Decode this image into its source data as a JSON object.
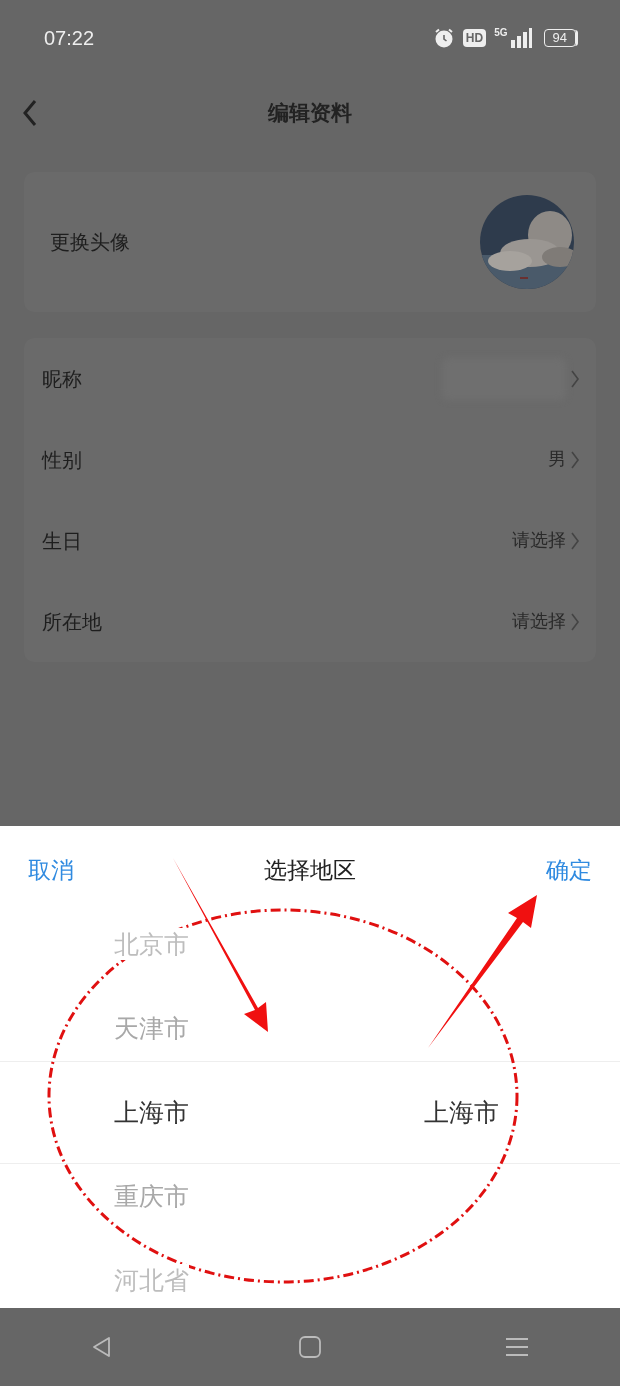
{
  "status_bar": {
    "time": "07:22",
    "hd": "HD",
    "network": "5G",
    "battery": "94"
  },
  "header": {
    "title": "编辑资料",
    "back": true
  },
  "avatar_row": {
    "label": "更换头像"
  },
  "fields": [
    {
      "label": "昵称",
      "blurred": true
    },
    {
      "label": "性别",
      "value": "男",
      "blurred": false
    },
    {
      "label": "生日",
      "value": "请选择",
      "blurred": false
    },
    {
      "label": "所在地",
      "value": "请选择",
      "blurred": false
    }
  ],
  "sheet": {
    "cancel": "取消",
    "title": "选择地区",
    "confirm": "确定",
    "columns": [
      {
        "items": [
          {
            "label": "北京市",
            "selected": false
          },
          {
            "label": "天津市",
            "selected": false
          },
          {
            "label": "上海市",
            "selected": true
          },
          {
            "label": "重庆市",
            "selected": false
          },
          {
            "label": "河北省",
            "selected": false
          }
        ]
      },
      {
        "items": [
          {
            "label": "上海市",
            "selected": true
          }
        ]
      }
    ]
  },
  "nav_bar": {
    "buttons": [
      {
        "kind": "back"
      },
      {
        "kind": "home"
      },
      {
        "kind": "menu"
      }
    ]
  }
}
